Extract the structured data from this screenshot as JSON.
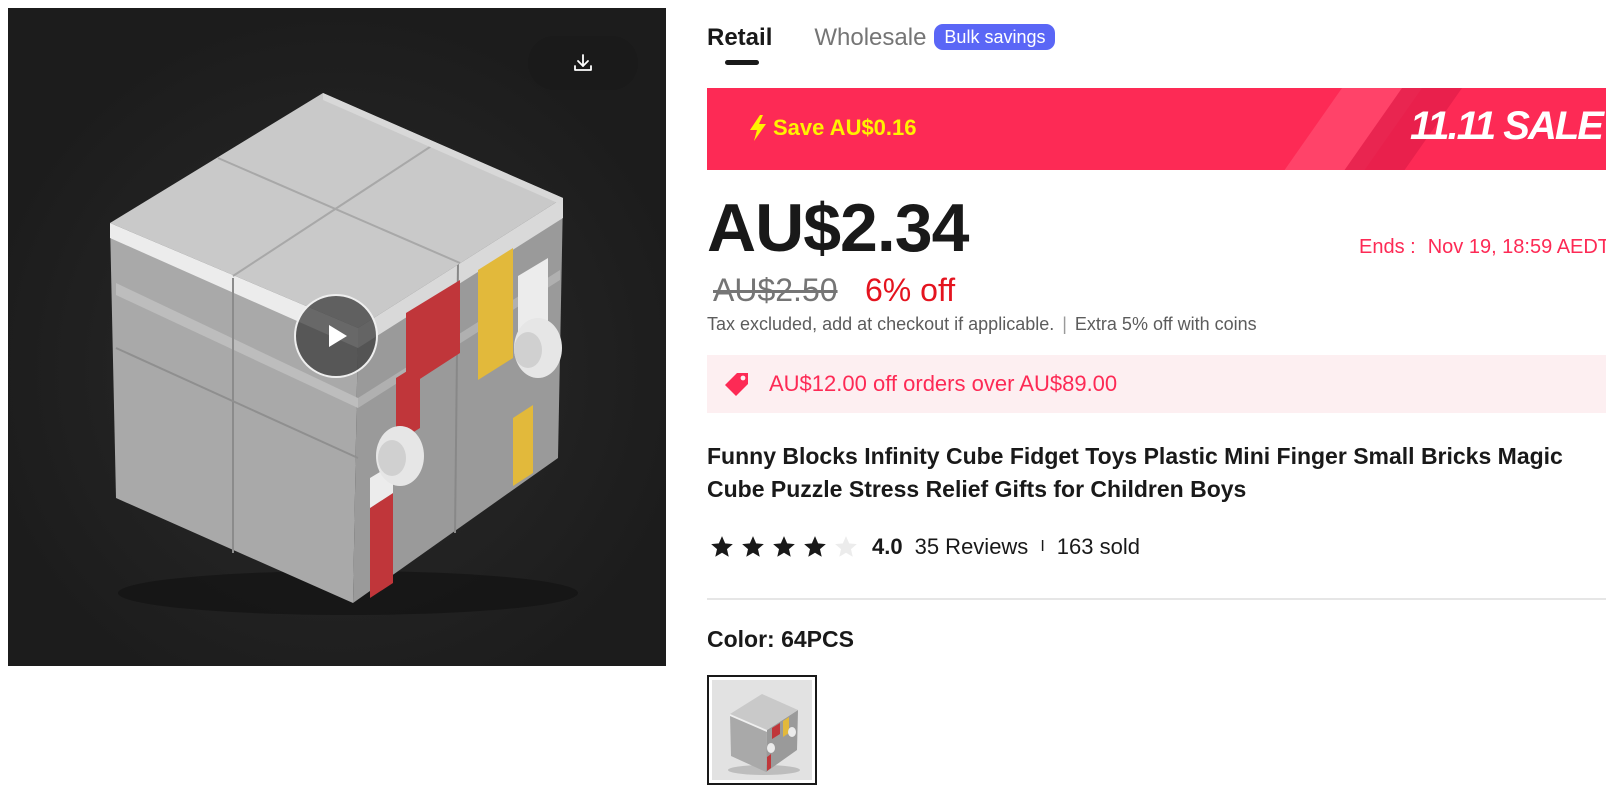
{
  "media": {
    "download_icon": "download-icon",
    "play_icon": "play-icon"
  },
  "tabs": [
    {
      "label": "Retail",
      "active": true
    },
    {
      "label": "Wholesale",
      "active": false,
      "badge": "Bulk savings"
    }
  ],
  "banner": {
    "save_text": "Save AU$0.16",
    "sale_text": "11.11 SALE",
    "icon": "lightning-icon",
    "colors": {
      "background": "#fd2a55",
      "save_text": "#fff200"
    }
  },
  "price": {
    "current": "AU$2.34",
    "original": "AU$2.50",
    "discount": "6% off",
    "ends_label": "Ends :",
    "ends_value": "Nov 19, 18:59 AEDT"
  },
  "tax": {
    "text": "Tax excluded, add at checkout if applicable.",
    "separator": "|",
    "coins": "Extra 5% off with coins"
  },
  "coupon": {
    "icon": "tag-icon",
    "text": "AU$12.00 off orders over AU$89.00"
  },
  "product": {
    "title": "Funny Blocks Infinity Cube Fidget Toys Plastic Mini Finger Small Bricks Magic Cube Puzzle Stress Relief Gifts for Children Boys"
  },
  "rating": {
    "stars": 4,
    "max_stars": 5,
    "value": "4.0",
    "reviews": "35 Reviews",
    "separator": "I",
    "sold": "163 sold"
  },
  "variant": {
    "label": "Color: 64PCS",
    "selected": "64PCS"
  }
}
